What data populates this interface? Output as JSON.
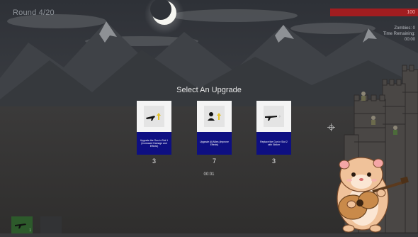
{
  "hud": {
    "title": "Round 4/20",
    "health": "100",
    "stats": [
      "Zombies: 0",
      "Time Remaining:",
      "00:00"
    ]
  },
  "upgrade_screen": {
    "heading": "Select An Upgrade",
    "cards": [
      {
        "icon": "rifle-up-icon",
        "description": "Upgrade the Gun in Slot 1 (Increased Damage and Effects)",
        "cost": "3"
      },
      {
        "icon": "ally-up-icon",
        "description": "Upgrade All Allies (Improve Effects)",
        "cost": "7"
      },
      {
        "icon": "shotgun-swap-icon",
        "description": "Replace the Gun in Slot 2 with Striker",
        "cost": "3"
      }
    ],
    "timer": "00:01"
  },
  "weapon_slots": [
    {
      "icon": "rifle-icon",
      "label": "1"
    },
    {
      "icon": "empty-slot-icon",
      "label": ""
    }
  ],
  "colors": {
    "card_desc_bg": "#0e0f82",
    "hp_bar": "#a11d20",
    "arrow": "#e4c22a",
    "slot_active": "#2d5a2b"
  }
}
